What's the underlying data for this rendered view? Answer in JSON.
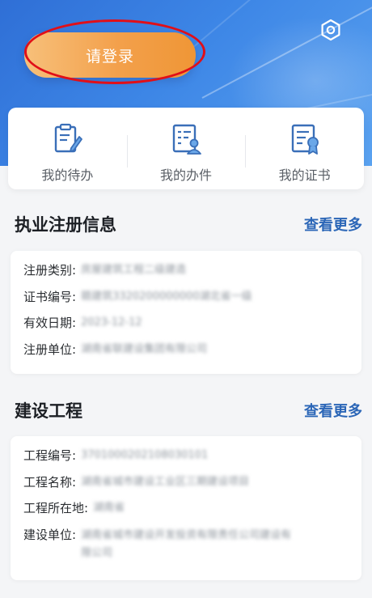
{
  "header": {
    "login_label": "请登录",
    "settings_icon": "gear-hex-icon"
  },
  "quick_actions": [
    {
      "label": "我的待办",
      "icon": "todo-clipboard-icon"
    },
    {
      "label": "我的办件",
      "icon": "person-list-icon"
    },
    {
      "label": "我的证书",
      "icon": "certificate-icon"
    }
  ],
  "registration": {
    "title": "执业注册信息",
    "more": "查看更多",
    "rows": [
      {
        "key": "注册类别:",
        "value": "房屋建筑工程二级建造"
      },
      {
        "key": "证书编号:",
        "value": "赣建筑3320200000000湖北省一级"
      },
      {
        "key": "有效日期:",
        "value": "2023-12-12"
      },
      {
        "key": "注册单位:",
        "value": "湖南省联建设集团有限公司"
      }
    ]
  },
  "project": {
    "title": "建设工程",
    "more": "查看更多",
    "rows": [
      {
        "key": "工程编号:",
        "value": "3701000202108030101"
      },
      {
        "key": "工程名称:",
        "value": "湖南省城市建设工业区三期建设项目"
      },
      {
        "key": "工程所在地:",
        "value": "湖南省"
      },
      {
        "key": "建设单位:",
        "value": "湖南省城市建设开发投资有限责任公司建设有限公司"
      }
    ]
  },
  "colors": {
    "hero_blue": "#3d86e6",
    "login_orange": "#f3a04b",
    "annotation_red": "#e10f18",
    "link_blue": "#2b66b7"
  }
}
